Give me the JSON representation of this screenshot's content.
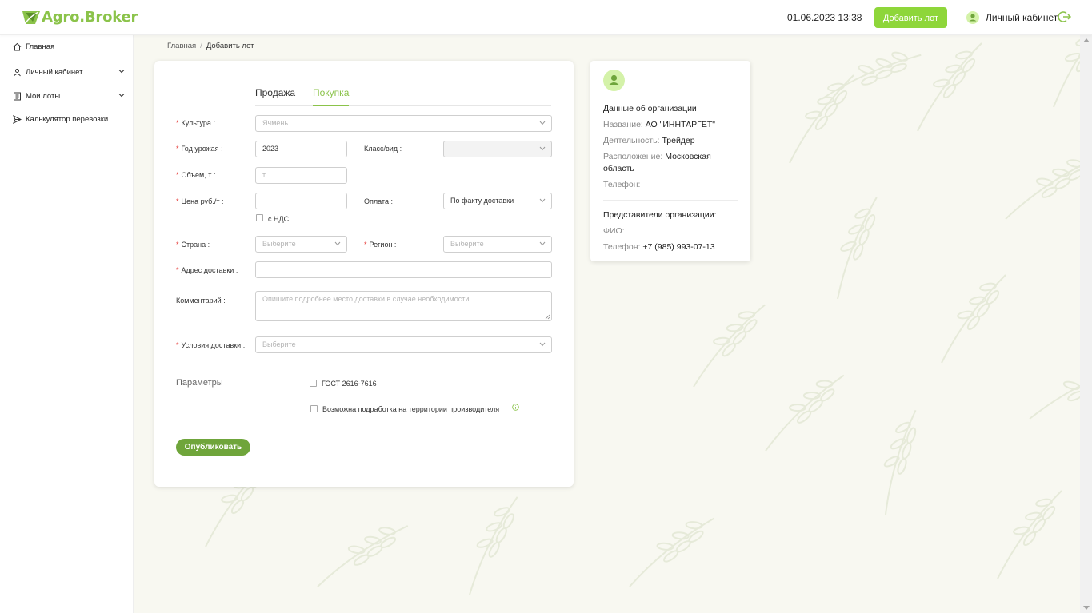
{
  "header": {
    "logo_text": "Agro.Broker",
    "datetime": "01.06.2023 13:38",
    "add_lot_button": "Добавить лот",
    "cabinet_label": "Личный кабинет"
  },
  "sidebar": {
    "items": [
      {
        "label": "Главная",
        "icon": "home-icon",
        "expandable": false
      },
      {
        "label": "Личный кабинет",
        "icon": "user-icon",
        "expandable": true
      },
      {
        "label": "Мои лоты",
        "icon": "document-icon",
        "expandable": true
      },
      {
        "label": "Калькулятор перевозки",
        "icon": "send-icon",
        "expandable": false
      }
    ]
  },
  "breadcrumb": {
    "home": "Главная",
    "separator": "/",
    "current": "Добавить лот"
  },
  "form": {
    "tabs": [
      {
        "label": "Продажа",
        "active": false
      },
      {
        "label": "Покупка",
        "active": true
      }
    ],
    "culture": {
      "label": "Культура",
      "placeholder": "Ячмень"
    },
    "harvest_year": {
      "label": "Год урожая",
      "value": "2023"
    },
    "class_type": {
      "label": "Класс/вид",
      "value": ""
    },
    "volume": {
      "label": "Объем, т",
      "placeholder": "т"
    },
    "price": {
      "label": "Цена руб./т",
      "value": ""
    },
    "vat": {
      "label": "с НДС",
      "checked": false
    },
    "payment": {
      "label": "Оплата",
      "value": "По факту доставки"
    },
    "country": {
      "label": "Страна",
      "placeholder": "Выберите"
    },
    "region": {
      "label": "Регион",
      "placeholder": "Выберите"
    },
    "address": {
      "label": "Адрес доставки",
      "value": ""
    },
    "comment": {
      "label": "Комментарий",
      "placeholder": "Опишите подробнее место доставки в случае необходимости"
    },
    "delivery_terms": {
      "label": "Условия доставки",
      "placeholder": "Выберите"
    },
    "parameters_label": "Параметры",
    "gost": {
      "label": "ГОСТ 2616-7616",
      "checked": false
    },
    "refinement": {
      "label": "Возможна подработка на территории производителя",
      "checked": false
    },
    "publish_button": "Опубликовать"
  },
  "organization": {
    "title": "Данные об организации",
    "name_key": "Название:",
    "name_value": "АО \"ИННТАРГЕТ\"",
    "activity_key": "Деятельность:",
    "activity_value": "Трейдер",
    "location_key": "Расположение:",
    "location_value": "Московская область",
    "phone_key": "Телефон:",
    "phone_value": "",
    "reps_title": "Представители организации:",
    "fio_key": "ФИО:",
    "fio_value": "",
    "rep_phone_key": "Телефон:",
    "rep_phone_value": "+7 (985) 993-07-13"
  },
  "colors": {
    "accent": "#8bc34a",
    "button_green": "#8ed63a",
    "publish_green": "#6fa53b",
    "required": "#e53935",
    "background": "#f8f8f1"
  }
}
